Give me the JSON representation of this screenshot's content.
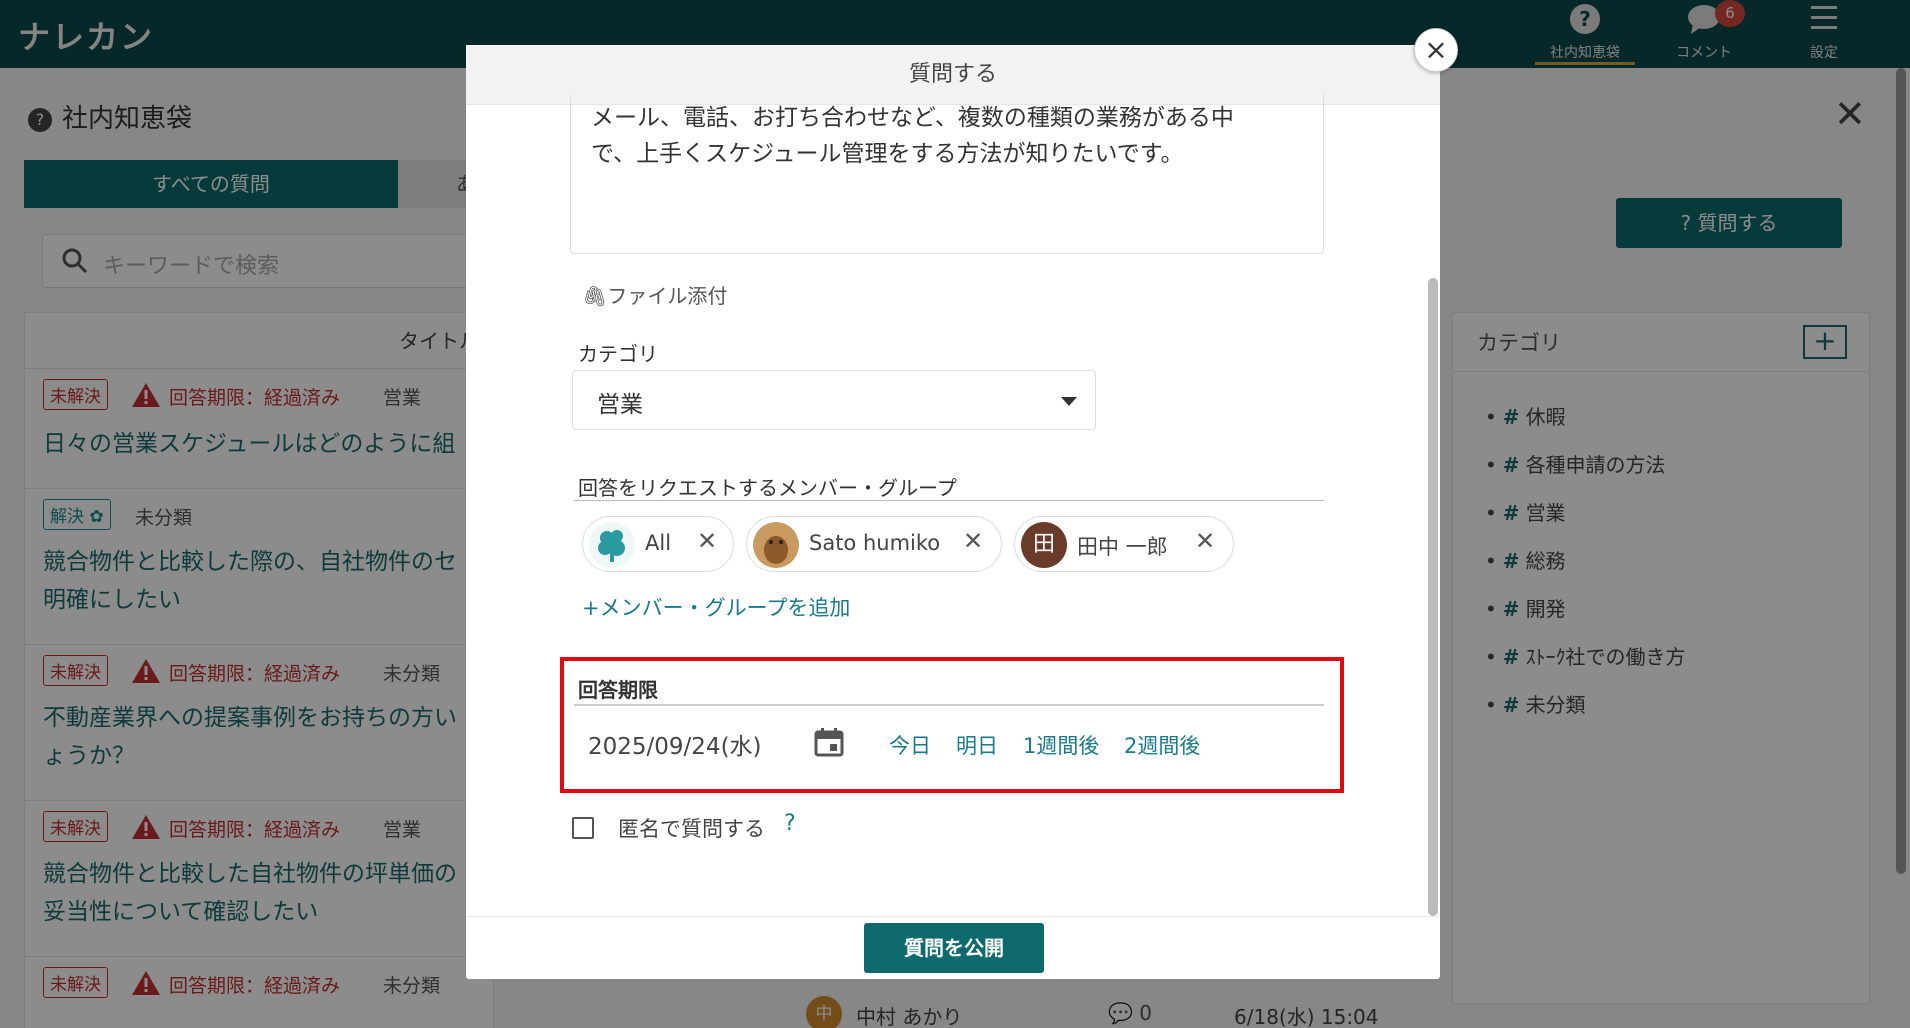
{
  "header": {
    "logo": "ナレカン",
    "nav": [
      {
        "label": "社内知恵袋",
        "icon": "question-circle-icon"
      },
      {
        "label": "コメント",
        "icon": "speech-bubble-icon",
        "badge": "6"
      },
      {
        "label": "設定",
        "icon": "hamburger-menu-icon"
      }
    ]
  },
  "page": {
    "title": "社内知恵袋",
    "tabs": [
      "すべての質問",
      "あ"
    ],
    "search_placeholder": "キーワードで検索",
    "list_header": "タイトル",
    "ask_button": "? 質問する",
    "questions": [
      {
        "status": "未解決",
        "deadline": "回答期限：経過済み",
        "category": "営業",
        "title": "日々の営業スケジュールはどのように組"
      },
      {
        "status": "解決",
        "deadline": "",
        "category": "未分類",
        "title": "競合物件と比較した際の、自社物件のセ\n明確にしたい"
      },
      {
        "status": "未解決",
        "deadline": "回答期限：経過済み",
        "category": "未分類",
        "title": "不動産業界への提案事例をお持ちの方い\nょうか？"
      },
      {
        "status": "未解決",
        "deadline": "回答期限：経過済み",
        "category": "営業",
        "title": "競合物件と比較した自社物件の坪単価の\n妥当性について確認したい"
      },
      {
        "status": "未解決",
        "deadline": "回答期限：経過済み",
        "category": "未分類",
        "title": ""
      }
    ],
    "footer_row": {
      "avatar_char": "中",
      "author": "中村 あかり",
      "comments": "0",
      "date": "6/18(水) 15:04"
    },
    "categories": {
      "title": "カテゴリ",
      "add_label": "+",
      "items": [
        "休暇",
        "各種申請の方法",
        "営業",
        "総務",
        "開発",
        "ｽﾄｰｸ社での働き方",
        "未分類"
      ]
    }
  },
  "modal": {
    "title": "質問する",
    "close_label": "×",
    "body_text": "メール、電話、お打ち合わせなど、複数の種類の業務がある中\nで、上手くスケジュール管理をする方法が知りたいです。",
    "attach_label": "ファイル添付",
    "category_label": "カテゴリ",
    "category_value": "営業",
    "request_label": "回答をリクエストするメンバー・グループ",
    "members": [
      {
        "name": "All",
        "avatar": "group-logo"
      },
      {
        "name": "Sato humiko",
        "avatar": "photo"
      },
      {
        "name": "田中 一郎",
        "avatar": "田"
      }
    ],
    "add_member_label": "+メンバー・グループを追加",
    "deadline_label": "回答期限",
    "deadline_value": "2025/09/24(水)",
    "quick_options": [
      "今日",
      "明日",
      "1週間後",
      "2週間後"
    ],
    "anonymous_label": "匿名で質問する",
    "anonymous_help": "?",
    "publish_label": "質問を公開",
    "highlight_color": "#e00a12"
  }
}
